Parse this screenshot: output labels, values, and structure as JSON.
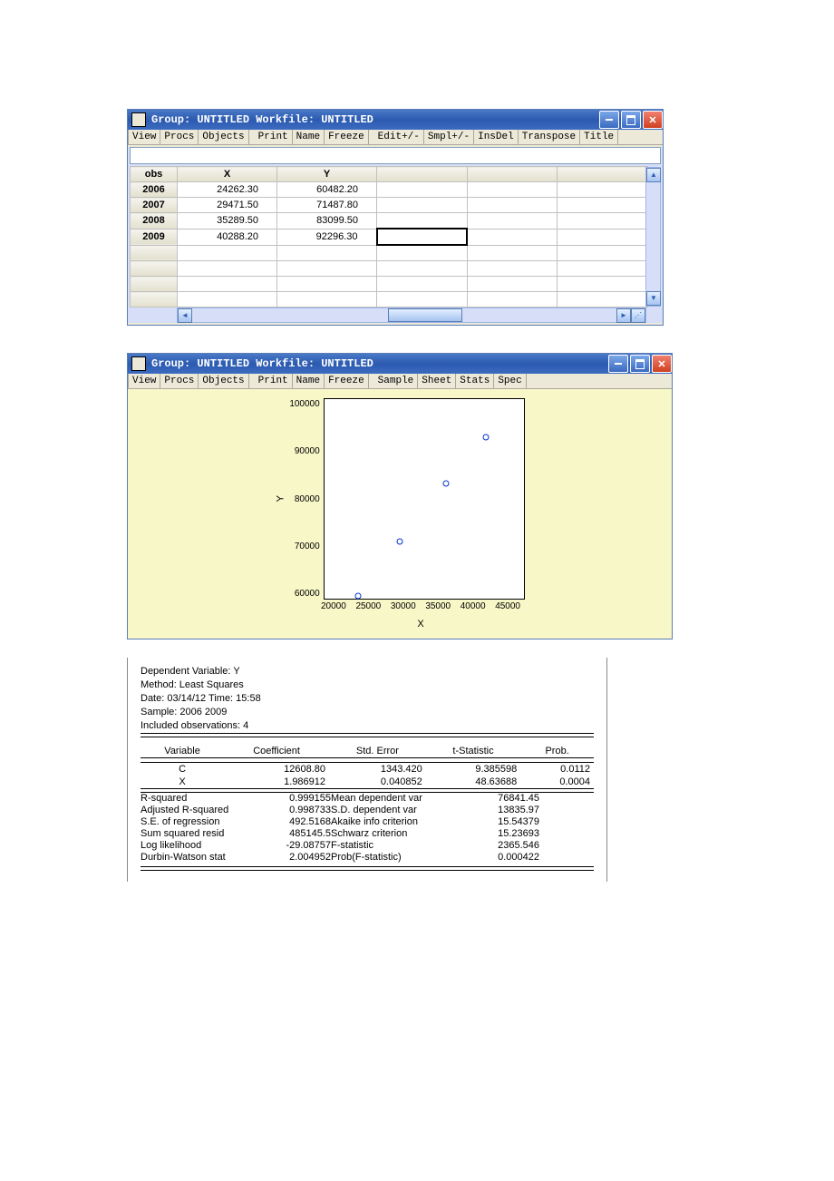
{
  "win1": {
    "title": "Group: UNTITLED   Workfile: UNTITLED",
    "toolbar": [
      "View",
      "Procs",
      "Objects",
      "Print",
      "Name",
      "Freeze",
      "Edit+/-",
      "Smpl+/-",
      "InsDel",
      "Transpose",
      "Title"
    ],
    "toolbar_groups": [
      [
        0,
        1,
        2
      ],
      [
        3,
        4,
        5
      ],
      [
        6,
        7,
        8,
        9,
        10
      ]
    ],
    "headers": [
      "obs",
      "X",
      "Y"
    ],
    "rows": [
      {
        "obs": "2006",
        "X": "24262.30",
        "Y": "60482.20"
      },
      {
        "obs": "2007",
        "X": "29471.50",
        "Y": "71487.80"
      },
      {
        "obs": "2008",
        "X": "35289.50",
        "Y": "83099.50"
      },
      {
        "obs": "2009",
        "X": "40288.20",
        "Y": "92296.30"
      }
    ]
  },
  "win2": {
    "title": "Group: UNTITLED   Workfile: UNTITLED",
    "toolbar": [
      "View",
      "Procs",
      "Objects",
      "Print",
      "Name",
      "Freeze",
      "Sample",
      "Sheet",
      "Stats",
      "Spec"
    ],
    "toolbar_groups": [
      [
        0,
        1,
        2
      ],
      [
        3,
        4,
        5
      ],
      [
        6,
        7,
        8,
        9
      ]
    ]
  },
  "chart_data": {
    "type": "scatter",
    "xlabel": "X",
    "ylabel": "Y",
    "xlim": [
      20000,
      45000
    ],
    "ylim": [
      60000,
      100000
    ],
    "xticks": [
      20000,
      25000,
      30000,
      35000,
      40000,
      45000
    ],
    "yticks": [
      60000,
      70000,
      80000,
      90000,
      100000
    ],
    "series": [
      {
        "name": "Y",
        "points": [
          {
            "x": 24262.3,
            "y": 60482.2
          },
          {
            "x": 29471.5,
            "y": 71487.8
          },
          {
            "x": 35289.5,
            "y": 83099.5
          },
          {
            "x": 40288.2,
            "y": 92296.3
          }
        ]
      }
    ]
  },
  "regress": {
    "header": [
      "Dependent Variable: Y",
      "Method: Least Squares",
      "Date: 03/14/12   Time: 15:58",
      "Sample: 2006 2009",
      "Included observations: 4"
    ],
    "cols": [
      "Variable",
      "Coefficient",
      "Std. Error",
      "t-Statistic",
      "Prob."
    ],
    "coeffs": [
      {
        "v": "C",
        "c": "12608.80",
        "se": "1343.420",
        "t": "9.385598",
        "p": "0.0112"
      },
      {
        "v": "X",
        "c": "1.986912",
        "se": "0.040852",
        "t": "48.63688",
        "p": "0.0004"
      }
    ],
    "stats": [
      {
        "l": "R-squared",
        "lv": "0.999155",
        "r": "Mean dependent var",
        "rv": "76841.45"
      },
      {
        "l": "Adjusted R-squared",
        "lv": "0.998733",
        "r": "S.D. dependent var",
        "rv": "13835.97"
      },
      {
        "l": "S.E. of regression",
        "lv": "492.5168",
        "r": "Akaike info criterion",
        "rv": "15.54379"
      },
      {
        "l": "Sum squared resid",
        "lv": "485145.5",
        "r": "Schwarz criterion",
        "rv": "15.23693"
      },
      {
        "l": "Log likelihood",
        "lv": "-29.08757",
        "r": "F-statistic",
        "rv": "2365.546"
      },
      {
        "l": "Durbin-Watson stat",
        "lv": "2.004952",
        "r": "Prob(F-statistic)",
        "rv": "0.000422"
      }
    ]
  }
}
